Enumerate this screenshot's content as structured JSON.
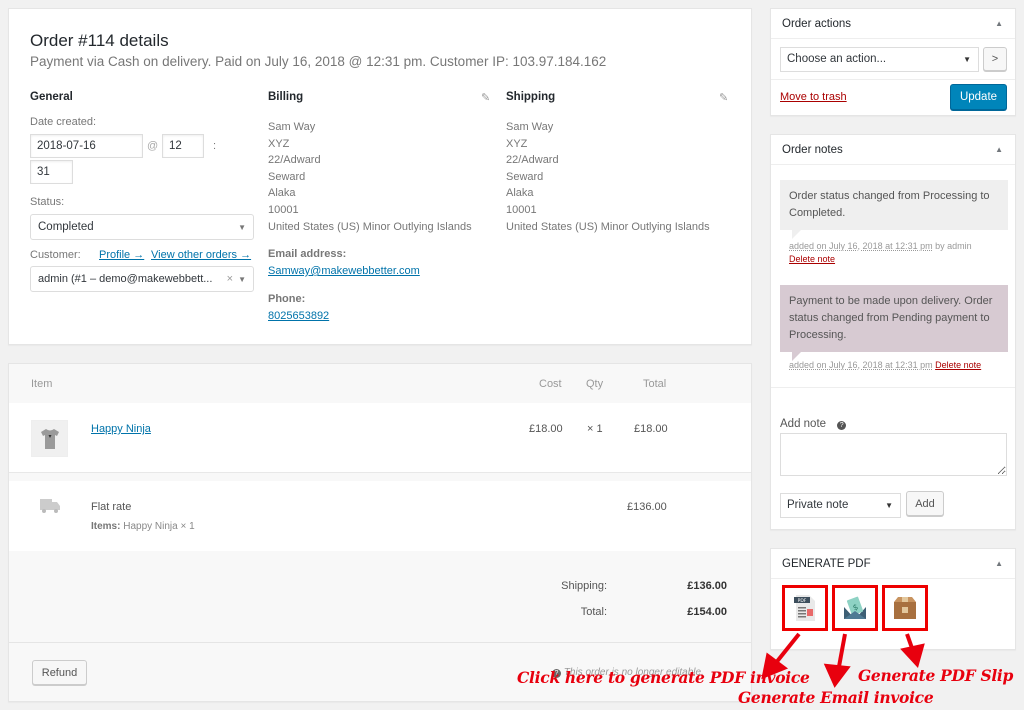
{
  "order": {
    "title": "Order #114 details",
    "subtitle": "Payment via Cash on delivery. Paid on July 16, 2018 @ 12:31 pm. Customer IP: 103.97.184.162",
    "general": {
      "heading": "General",
      "date_label": "Date created:",
      "date_value": "2018-07-16",
      "at_sign": "@",
      "hour_value": "12",
      "colon": ":",
      "minute_value": "31",
      "status_label": "Status:",
      "status_value": "Completed",
      "customer_label": "Customer:",
      "profile_link": "Profile →",
      "view_orders_link": "View other orders →",
      "customer_value": "admin (#1 – demo@makewebbett...",
      "clear_glyph": "×"
    },
    "billing": {
      "heading": "Billing",
      "lines": [
        "Sam Way",
        "XYZ",
        "22/Adward",
        "Seward",
        "Alaka",
        "10001",
        "United States (US) Minor Outlying Islands"
      ],
      "email_label": "Email address:",
      "email": "Samway@makewebbetter.com",
      "phone_label": "Phone:",
      "phone": "8025653892"
    },
    "shipping": {
      "heading": "Shipping",
      "lines": [
        "Sam Way",
        "XYZ",
        "22/Adward",
        "Seward",
        "Alaka",
        "10001",
        "United States (US) Minor Outlying Islands"
      ]
    }
  },
  "items": {
    "headers": {
      "item": "Item",
      "cost": "Cost",
      "qty": "Qty",
      "total": "Total"
    },
    "rows": [
      {
        "name": "Happy Ninja",
        "cost": "£18.00",
        "qty": "× 1",
        "total": "£18.00"
      }
    ],
    "shipping_row": {
      "name": "Flat rate",
      "items_label": "Items:",
      "items_value": "Happy Ninja × 1",
      "total": "£136.00"
    },
    "totals": [
      {
        "label": "Shipping:",
        "value": "£136.00"
      },
      {
        "label": "Total:",
        "value": "£154.00"
      }
    ],
    "refund_button": "Refund",
    "not_editable": "This order is no longer editable."
  },
  "order_actions": {
    "title": "Order actions",
    "select_value": "Choose an action...",
    "go_glyph": ">",
    "trash_link": "Move to trash",
    "update_button": "Update"
  },
  "order_notes": {
    "title": "Order notes",
    "notes": [
      {
        "text": "Order status changed from Processing to Completed.",
        "date": "added on July 16, 2018 at 12:31 pm",
        "by": " by admin",
        "delete": "Delete note",
        "color": "#efefef"
      },
      {
        "text": "Payment to be made upon delivery. Order status changed from Pending payment to Processing.",
        "date": "added on July 16, 2018 at 12:31 pm",
        "by": " ",
        "delete": "Delete note",
        "color": "#d7cad2"
      }
    ],
    "add_note_label": "Add note",
    "add_note_value": "",
    "note_type": "Private note",
    "add_button": "Add"
  },
  "generate_pdf": {
    "title": "GENERATE PDF",
    "buttons": [
      "pdf-invoice",
      "email-invoice",
      "pdf-slip"
    ]
  },
  "annotations": {
    "pdf_invoice": "Click here to generate PDF invoice",
    "email_invoice": "Generate Email invoice",
    "pdf_slip": "Generate PDF Slip",
    "color": "#e8000e"
  },
  "colors": {
    "link": "#0073aa",
    "primary": "#0085ba",
    "danger": "#a00"
  }
}
